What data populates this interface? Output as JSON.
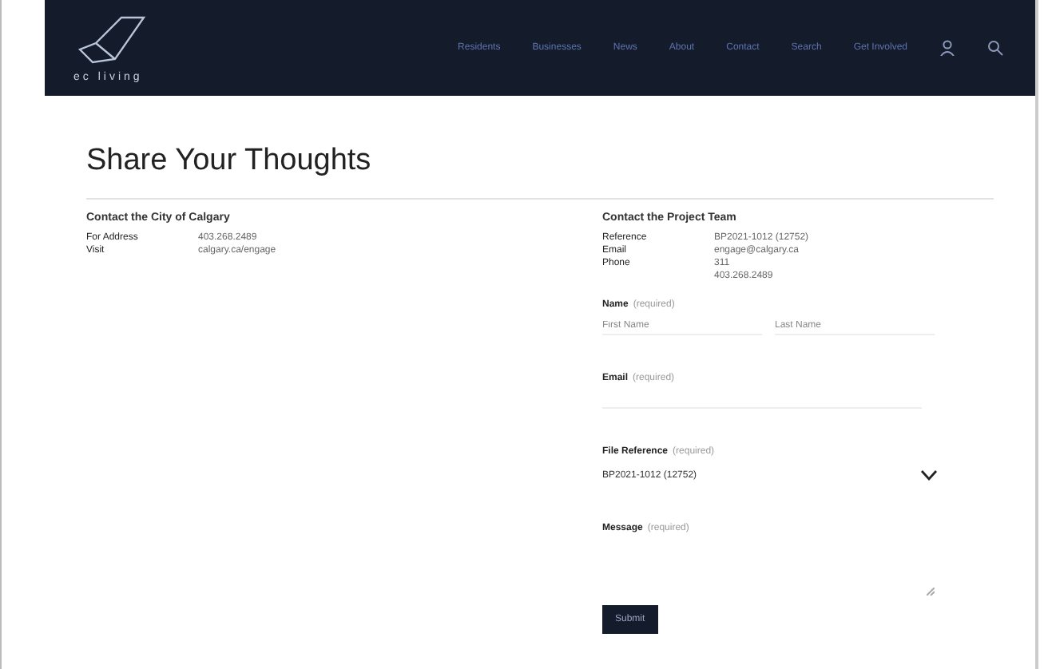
{
  "header": {
    "logo_text": "ec living",
    "nav": [
      "Residents",
      "Businesses",
      "News",
      "About",
      "Contact",
      "Search",
      "Get Involved"
    ]
  },
  "title": "Share Your Thoughts",
  "city_contact": {
    "heading": "Contact the City of Calgary",
    "rows": [
      {
        "label": "For Address",
        "value": "403.268.2489"
      },
      {
        "label": "Visit",
        "value": "calgary.ca/engage"
      }
    ]
  },
  "project_contact": {
    "heading": "Contact the Project Team",
    "rows": [
      {
        "label": "Reference",
        "value": "BP2021-1012 (12752)"
      },
      {
        "label": "Email",
        "value": "engage@calgary.ca"
      },
      {
        "label": "Phone",
        "value": "311"
      },
      {
        "label": "",
        "value": "403.268.2489"
      }
    ]
  },
  "form": {
    "name": {
      "label": "Name",
      "hint": "(required)",
      "first_placeholder": "First Name",
      "last_placeholder": "Last Name"
    },
    "email": {
      "label": "Email",
      "hint": "(required)"
    },
    "reference": {
      "label": "File Reference",
      "hint": "(required)",
      "value": "BP2021-1012 (12752)"
    },
    "message": {
      "label": "Message",
      "hint": "(required)"
    },
    "submit": "Submit"
  }
}
